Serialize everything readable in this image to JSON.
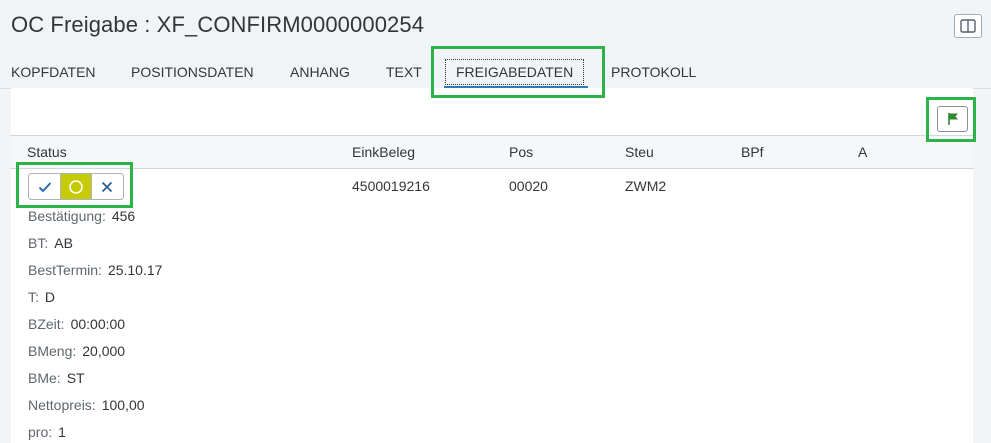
{
  "header": {
    "title": "OC Freigabe : XF_CONFIRM0000000254"
  },
  "tabs": [
    {
      "label": "KOPFDATEN"
    },
    {
      "label": "POSITIONSDATEN"
    },
    {
      "label": "ANHANG"
    },
    {
      "label": "TEXT"
    },
    {
      "label": "FREIGABEDATEN",
      "active": true
    },
    {
      "label": "PROTOKOLL"
    }
  ],
  "colors": {
    "accent": "#2b7cb8",
    "highlight": "#2eb24a",
    "selected_segment": "#c5cb00",
    "flag": "#2e8a2e"
  },
  "table": {
    "columns": [
      "Status",
      "EinkBeleg",
      "Pos",
      "Steu",
      "BPf",
      "A"
    ],
    "row": {
      "einkbeleg": "4500019216",
      "pos": "00020",
      "steu": "ZWM2",
      "status_options": [
        "accept-icon",
        "pending-icon",
        "reject-icon"
      ],
      "status_selected": "pending-icon",
      "details": [
        {
          "label": "Bestätigung:",
          "value": "456"
        },
        {
          "label": "BT:",
          "value": "AB"
        },
        {
          "label": "BestTermin:",
          "value": "25.10.17"
        },
        {
          "label": "T:",
          "value": "D"
        },
        {
          "label": "BZeit:",
          "value": "00:00:00"
        },
        {
          "label": "BMeng:",
          "value": "20,000"
        },
        {
          "label": "BMe:",
          "value": "ST"
        },
        {
          "label": "Nettopreis:",
          "value": "100,00"
        },
        {
          "label": "pro:",
          "value": "1"
        }
      ]
    }
  }
}
